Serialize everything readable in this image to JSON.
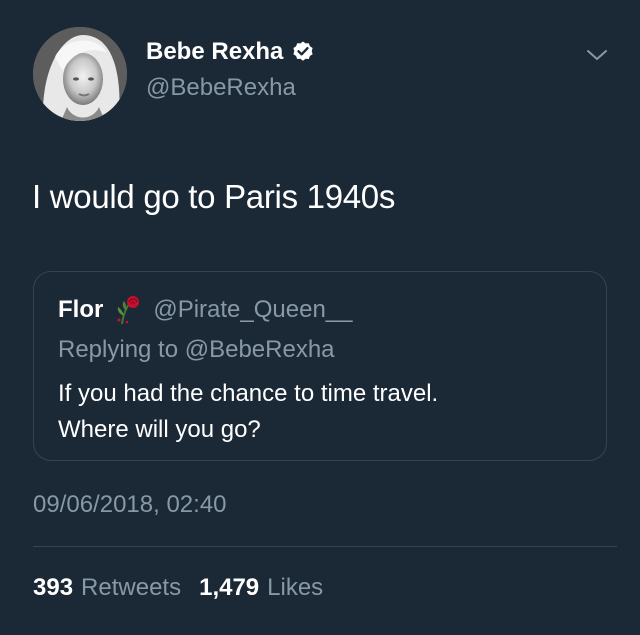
{
  "author": {
    "name": "Bebe Rexha",
    "handle": "@BebeRexha"
  },
  "tweet": {
    "text": "I would go to Paris 1940s"
  },
  "quoted_tweet": {
    "name": "Flor",
    "handle": "@Pirate_Queen__",
    "replying_to": "Replying to @BebeRexha",
    "lines": [
      "If you had the chance to time travel.",
      "Where will you go?"
    ]
  },
  "timestamp": "09/06/2018, 02:40",
  "stats": {
    "retweets_count": "393",
    "retweets_label": "Retweets",
    "likes_count": "1,479",
    "likes_label": "Likes"
  },
  "colors": {
    "background": "#1b2836",
    "primary_text": "#ffffff",
    "secondary_text": "#8899a6",
    "border": "#38444d"
  },
  "icons": [
    "verified-badge-icon",
    "chevron-down-icon",
    "rose-emoji-icon"
  ]
}
